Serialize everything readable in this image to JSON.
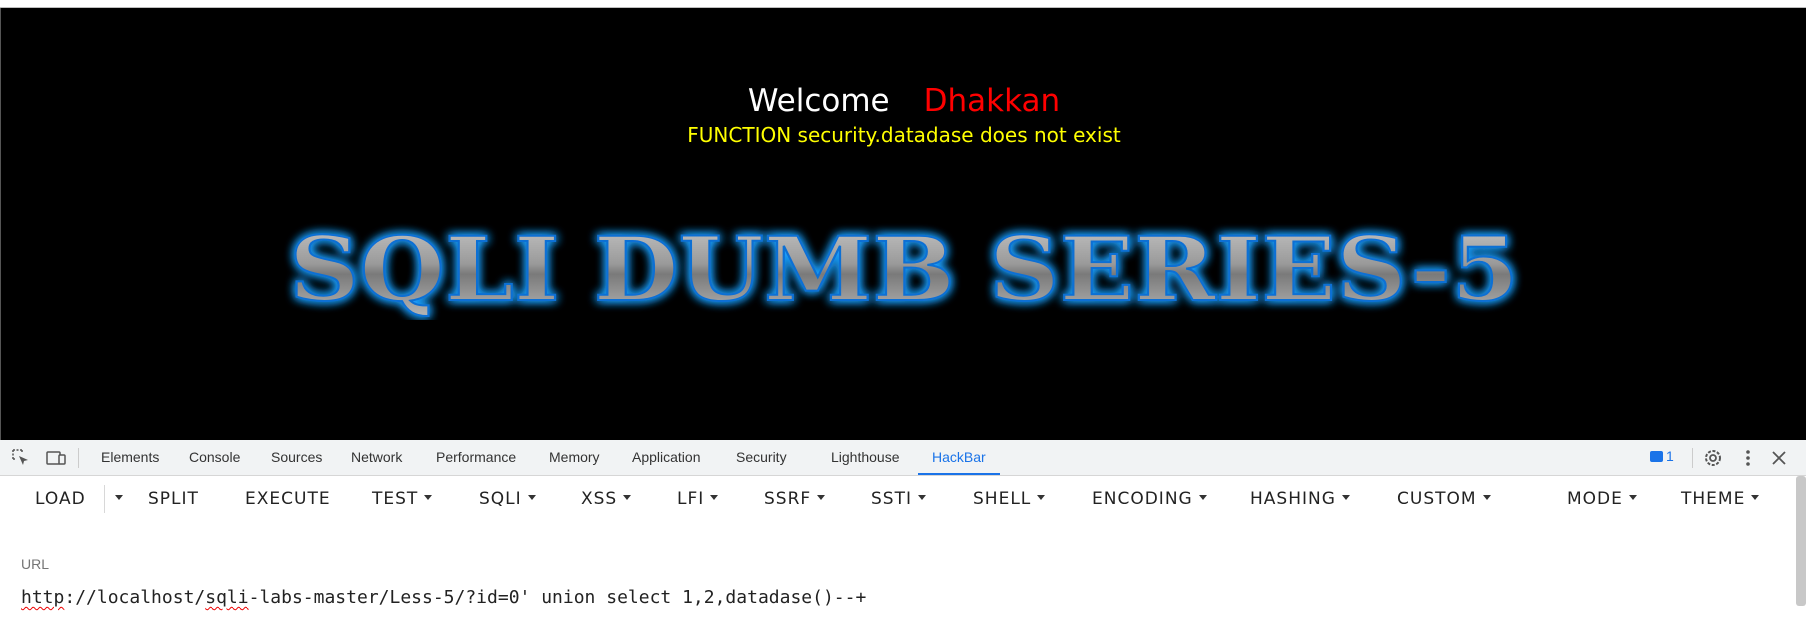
{
  "page": {
    "welcome_label": "Welcome",
    "user_name": "Dhakkan",
    "error_message": "FUNCTION security.datadase does not exist",
    "banner_title": "SQLI DUMB SERIES-5",
    "colors": {
      "background": "#000000",
      "welcome": "#ffffff",
      "name": "#ff0000",
      "error": "#ffff00",
      "banner_glow": "#1ea0ff"
    }
  },
  "devtools": {
    "tabs": [
      "Elements",
      "Console",
      "Sources",
      "Network",
      "Performance",
      "Memory",
      "Application",
      "Security",
      "Lighthouse",
      "HackBar"
    ],
    "active_tab": "HackBar",
    "issues_count": "1",
    "icons": [
      "inspect-element-icon",
      "device-toolbar-icon",
      "issues-icon",
      "settings-gear-icon",
      "more-vert-icon",
      "close-icon"
    ]
  },
  "hackbar": {
    "buttons": [
      "LOAD",
      "SPLIT",
      "EXECUTE",
      "TEST",
      "SQLI",
      "XSS",
      "LFI",
      "SSRF",
      "SSTI",
      "SHELL",
      "ENCODING",
      "HASHING",
      "CUSTOM",
      "MODE",
      "THEME"
    ],
    "url_label": "URL",
    "url_scheme": "http",
    "url_host_part": "://localhost/",
    "url_spell": "sqli",
    "url_rest": "-labs-master/Less-5/?id=0' union select 1,2,datadase()--+"
  }
}
